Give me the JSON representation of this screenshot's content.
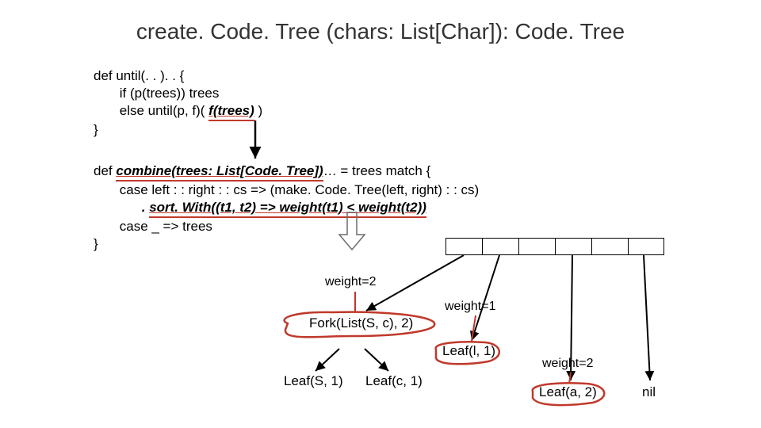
{
  "title": "create. Code. Tree (chars: List[Char]): Code. Tree",
  "code": {
    "until": {
      "l1": "def until(. . ). . {",
      "l2": "if (p(trees)) trees",
      "l3a": "else until(p, f)( ",
      "l3b": "f(trees)",
      "l3c": " )",
      "l4": "}"
    },
    "combine": {
      "l1a": "def ",
      "l1b": "combine(trees: List[Code. Tree])",
      "l1c": "… = trees match {",
      "l2": "case left : : right : : cs => (make. Code. Tree(left, right) : : cs)",
      "l3a": ". ",
      "l3b": "sort. With((t1, t2) => weight(t1) < weight(t2))",
      "l4": "case _ => trees",
      "l5": "}"
    }
  },
  "weights": {
    "w_fork": "weight=2",
    "w_leaf_l": "weight=1",
    "w_leaf_a": "weight=2"
  },
  "diagram": {
    "fork_label": "Fork(List(S, c), 2)",
    "leaf_s": "Leaf(S, 1)",
    "leaf_c": "Leaf(c, 1)",
    "leaf_l": "Leaf(l, 1)",
    "leaf_a": "Leaf(a, 2)",
    "nil": "nil"
  }
}
